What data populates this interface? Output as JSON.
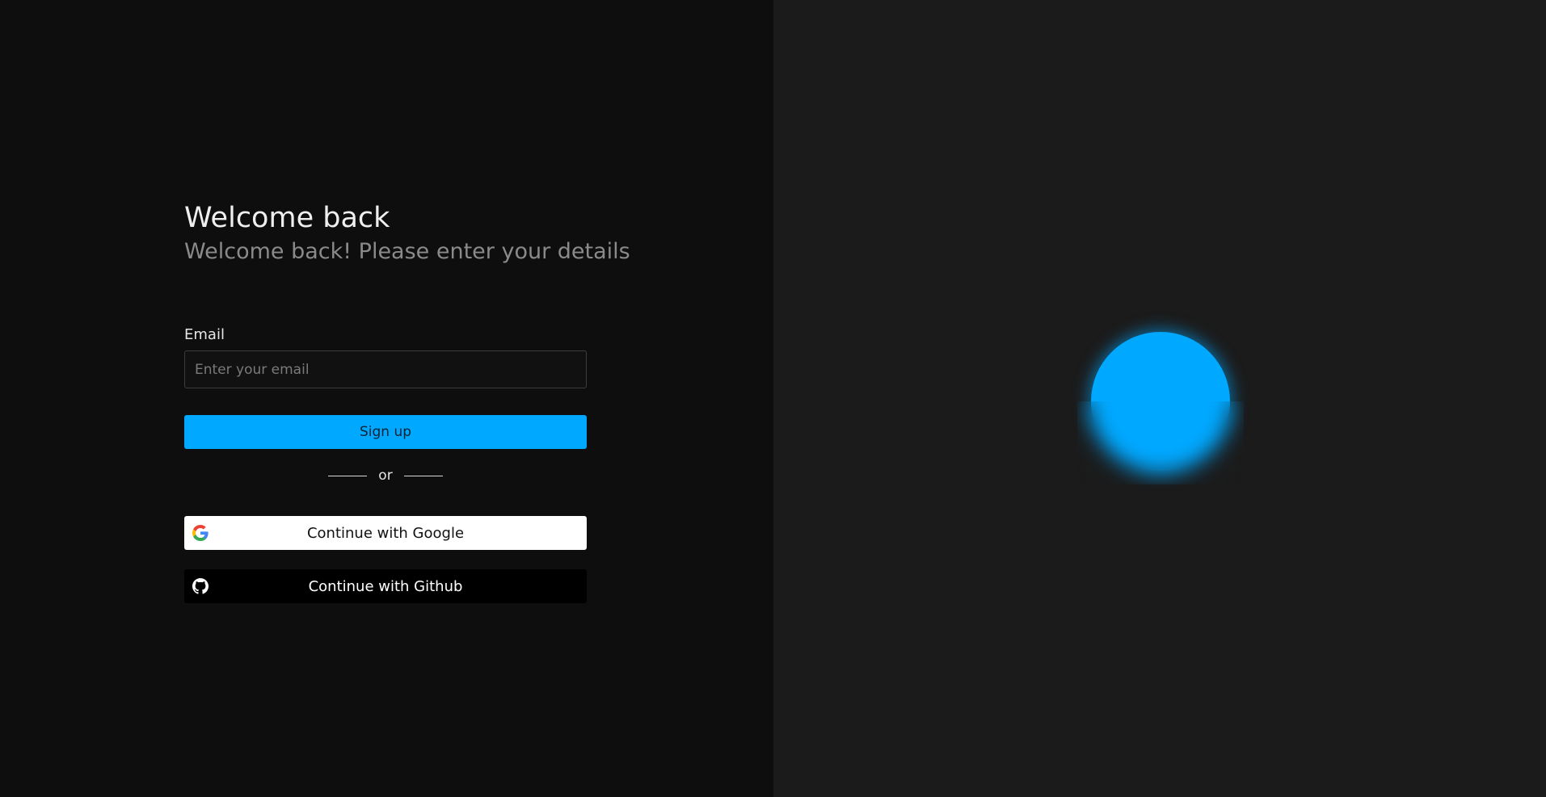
{
  "login": {
    "title": "Welcome back",
    "subtitle": "Welcome back! Please enter your details",
    "email_label": "Email",
    "email_placeholder": "Enter your email",
    "email_value": "",
    "signup_label": "Sign up",
    "divider_text": "or",
    "google_label": "Continue with Google",
    "github_label": "Continue with Github"
  },
  "icons": {
    "google": "google-icon",
    "github": "github-icon"
  },
  "colors": {
    "left_background": "#0e0e0e",
    "right_background": "#1b1b1b",
    "accent": "#00a8ff",
    "google_button": "#ffffff",
    "github_button": "#000000"
  }
}
